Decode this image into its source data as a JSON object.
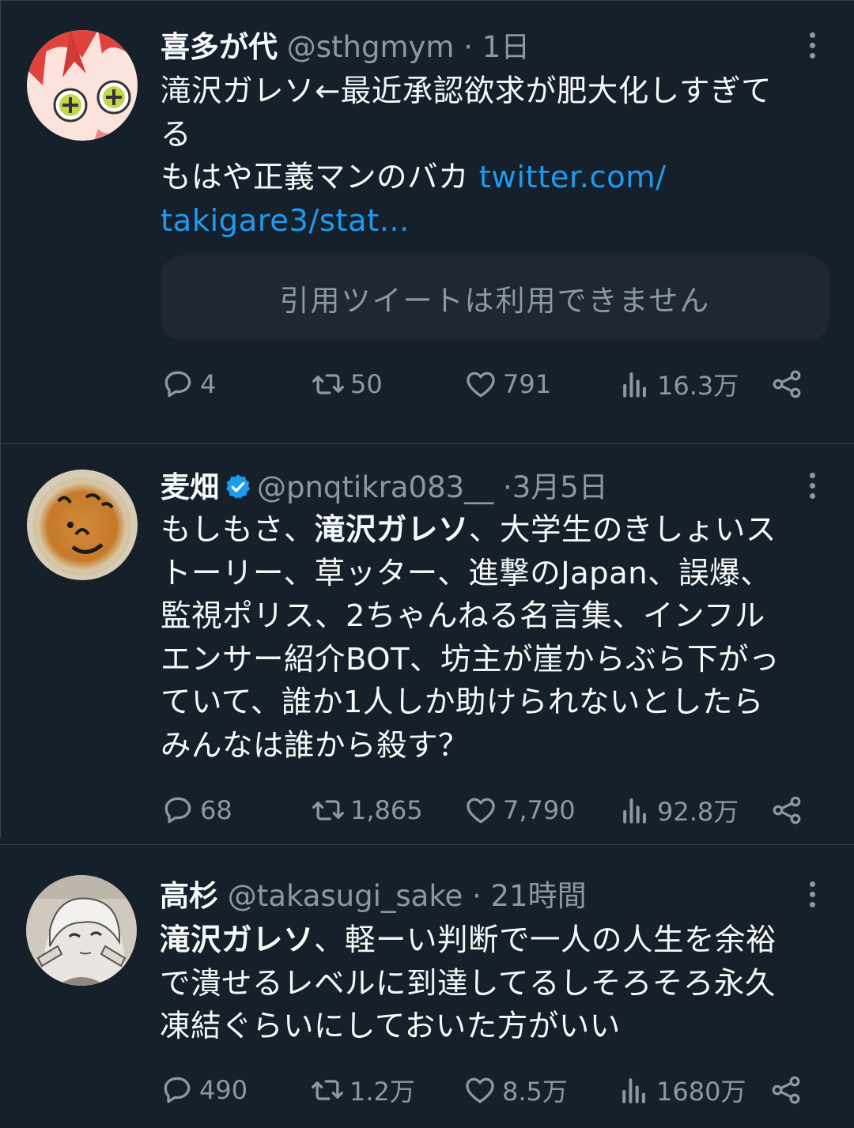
{
  "colors": {
    "background": "#15202b",
    "text_primary": "#f7f9f9",
    "text_secondary": "#8b98a5",
    "link": "#1d9bf0",
    "verified": "#1d9bf0",
    "divider": "#38444d"
  },
  "tweets": [
    {
      "display_name": "喜多が代",
      "handle": "@sthgmym",
      "separator": "·",
      "time": "1日",
      "verified": false,
      "body_lines": [
        "滝沢ガレソ←最近承認欲求が肥大化しすぎて",
        "る"
      ],
      "body_line3_text": "もはや正義マンのバカ ",
      "body_line3_link": "twitter.com/",
      "body_line4_link": "takigare3/stat...",
      "quote_unavailable": "引用ツイートは利用できません",
      "replies": "4",
      "retweets": "50",
      "likes": "791",
      "views": "16.3万",
      "icons": {
        "reply": "reply-icon",
        "retweet": "retweet-icon",
        "like": "heart-icon",
        "views": "views-icon",
        "share": "share-icon",
        "more": "more-icon"
      }
    },
    {
      "display_name": "麦畑",
      "handle": "@pnqtikra083__",
      "separator": "·",
      "time": "3月5日",
      "verified": true,
      "body_line1_pre": "もしもさ、",
      "body_line1_bold": "滝沢ガレソ",
      "body_line1_post": "、大学生のきしょいス",
      "body_lines": [
        "トーリー、草ッター、進撃のJapan、誤爆、",
        "監視ポリス、2ちゃんねる名言集、インフル",
        "エンサー紹介BOT、坊主が崖からぶら下がっ",
        "ていて、誰か1人しか助けられないとしたら",
        "みんなは誰から殺す？"
      ],
      "replies": "68",
      "retweets": "1,865",
      "likes": "7,790",
      "views": "92.8万"
    },
    {
      "display_name": "高杉",
      "handle": "@takasugi_sake",
      "separator": "·",
      "time": "21時間",
      "verified": false,
      "body_line1_bold": "滝沢ガレソ",
      "body_line1_post": "、軽ーい判断で一人の人生を余裕",
      "body_lines": [
        "で潰せるレベルに到達してるしそろそろ永久",
        "凍結ぐらいにしておいた方がいい"
      ],
      "replies": "490",
      "retweets": "1.2万",
      "likes": "8.5万",
      "views": "1680万"
    }
  ]
}
